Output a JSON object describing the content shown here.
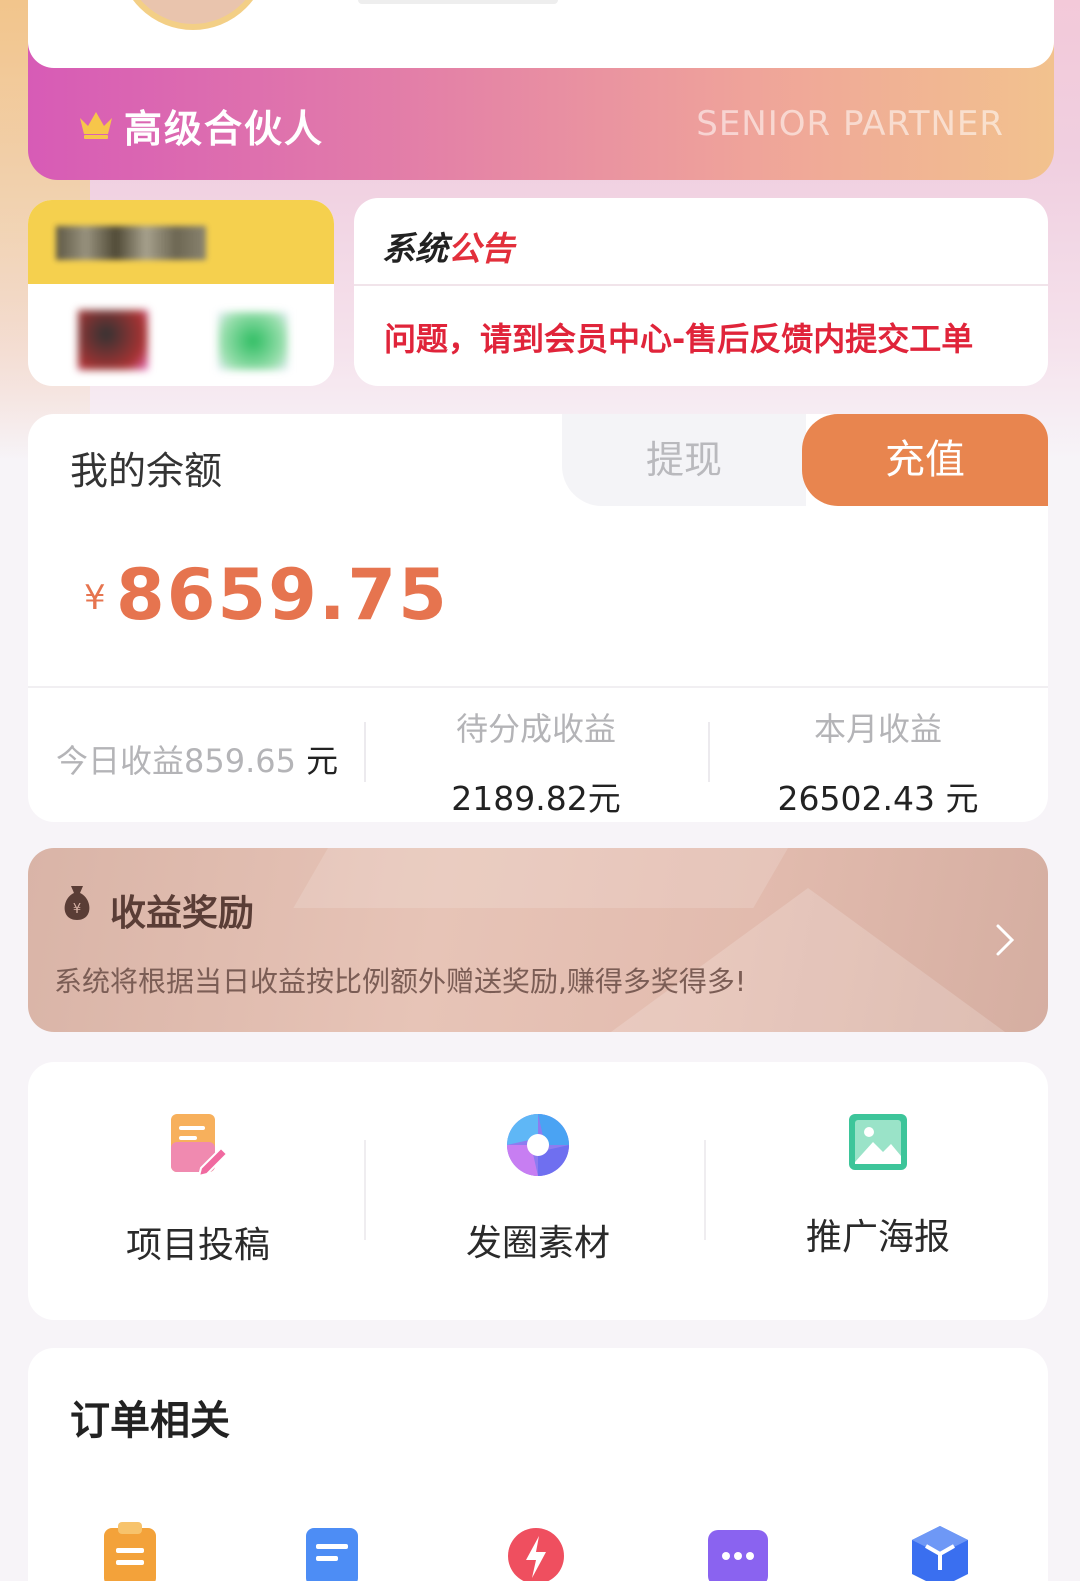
{
  "header": {
    "partner_title": "高级合伙人",
    "partner_en": "SENIOR PARTNER",
    "gradient_colors": [
      "#d75bb6",
      "#f2c28e"
    ]
  },
  "notice": {
    "title_part1": "系统",
    "title_part2": "公告",
    "text": "问题，请到会员中心-售后反馈内提交工单"
  },
  "balance": {
    "label": "我的余额",
    "withdraw_label": "提现",
    "recharge_label": "充值",
    "currency_symbol": "¥",
    "amount": "8659.75",
    "today_label": "今日收益859.65",
    "today_unit": "元",
    "pending_label": "待分成收益",
    "pending_value": "2189.82元",
    "month_label": "本月收益",
    "month_value": "26502.43 元",
    "accent_color": "#e8854f"
  },
  "reward": {
    "title": "收益奖励",
    "desc": "系统将根据当日收益按比例额外赠送奖励,赚得多奖得多!",
    "icon": "money-bag-icon"
  },
  "tools": {
    "items": [
      {
        "label": "项目投稿",
        "icon": "document-edit-icon"
      },
      {
        "label": "发圈素材",
        "icon": "aperture-icon"
      },
      {
        "label": "推广海报",
        "icon": "image-icon"
      }
    ]
  },
  "orders": {
    "title": "订单相关",
    "icons": [
      "clipboard-icon",
      "list-icon",
      "flash-icon",
      "more-icon",
      "box-icon"
    ]
  }
}
